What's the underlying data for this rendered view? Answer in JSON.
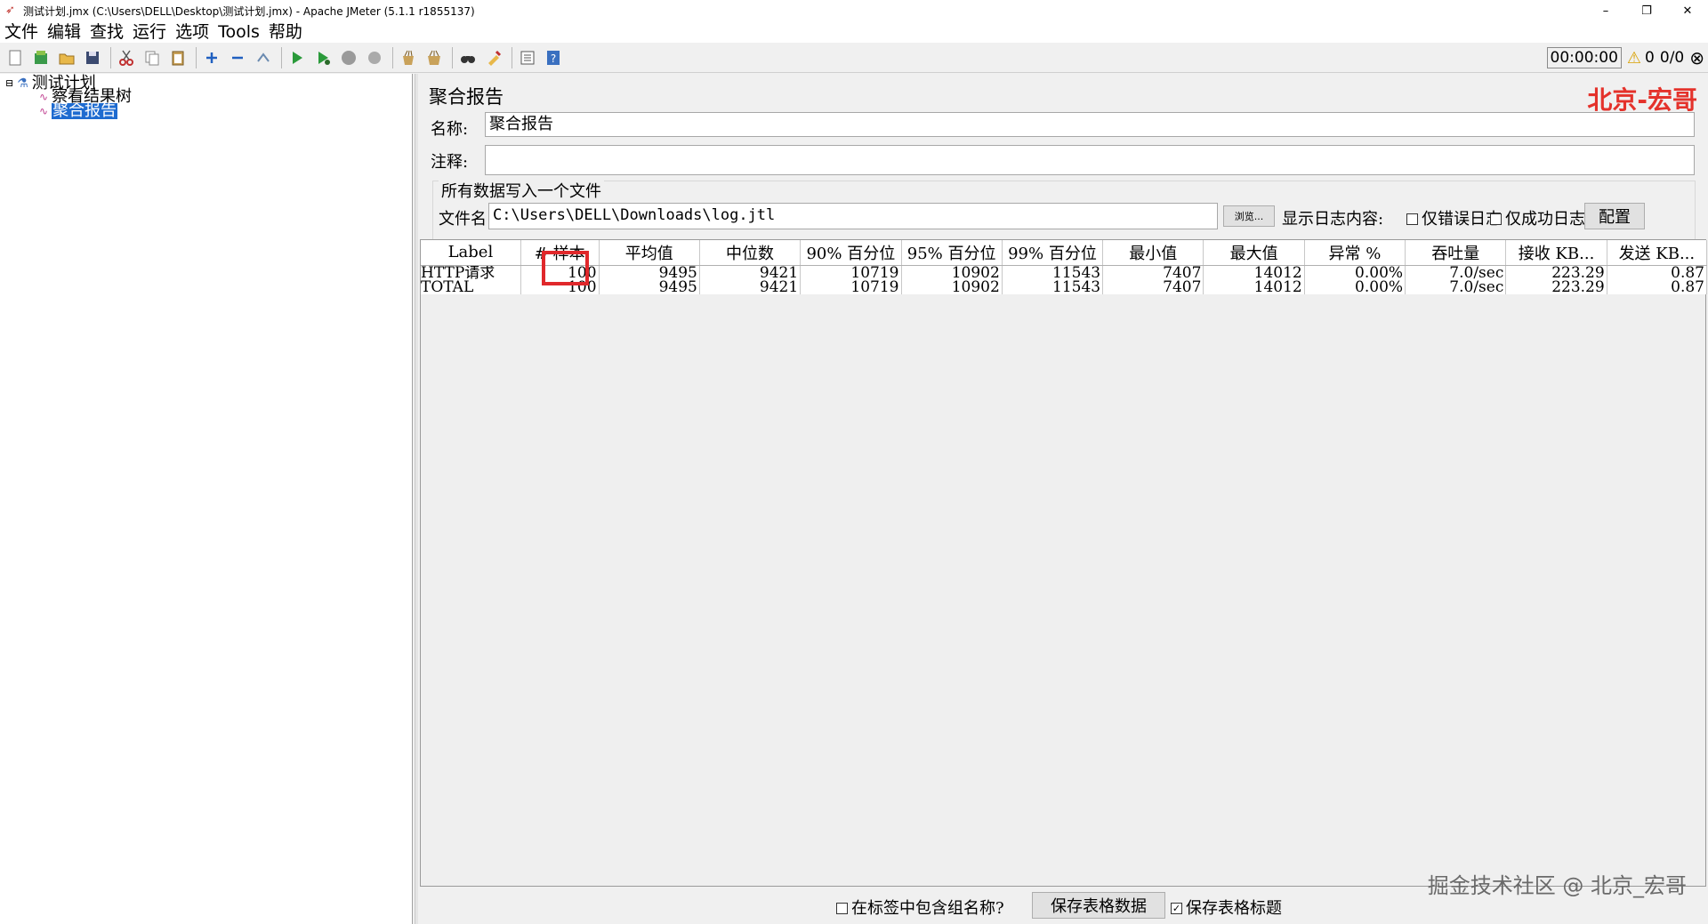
{
  "window": {
    "title": "测试计划.jmx (C:\\Users\\DELL\\Desktop\\测试计划.jmx) - Apache JMeter (5.1.1 r1855137)",
    "minimize": "–",
    "restore": "❐",
    "close": "✕"
  },
  "menu": [
    "文件",
    "编辑",
    "查找",
    "运行",
    "选项",
    "Tools",
    "帮助"
  ],
  "toolbar": {
    "timer": "00:00:00",
    "warning_count": "0",
    "threads": "0/0"
  },
  "tree": {
    "root": "测试计划",
    "children": [
      "察看结果树",
      "聚合报告"
    ],
    "selected_index": 1
  },
  "panel": {
    "title": "聚合报告",
    "watermark_top": "北京-宏哥",
    "name_label": "名称:",
    "name_value": "聚合报告",
    "comment_label": "注释:",
    "comment_value": "",
    "file_group_title": "所有数据写入一个文件",
    "filename_label": "文件名",
    "filename_value": "C:\\Users\\DELL\\Downloads\\log.jtl",
    "browse_button": "浏览...",
    "log_display_label": "显示日志内容:",
    "errors_only_label": "仅错误日志",
    "success_only_label": "仅成功日志",
    "config_button": "配置"
  },
  "table": {
    "headers": [
      "Label",
      "# 样本",
      "平均值",
      "中位数",
      "90% 百分位",
      "95% 百分位",
      "99% 百分位",
      "最小值",
      "最大值",
      "异常 %",
      "吞吐量",
      "接收 KB...",
      "发送 KB..."
    ],
    "rows": [
      [
        "HTTP请求",
        "100",
        "9495",
        "9421",
        "10719",
        "10902",
        "11543",
        "7407",
        "14012",
        "0.00%",
        "7.0/sec",
        "223.29",
        "0.87"
      ],
      [
        "TOTAL",
        "100",
        "9495",
        "9421",
        "10719",
        "10902",
        "11543",
        "7407",
        "14012",
        "0.00%",
        "7.0/sec",
        "223.29",
        "0.87"
      ]
    ]
  },
  "bottom": {
    "include_group_label": "在标签中包含组名称?",
    "save_table_button": "保存表格数据",
    "save_header_label": "保存表格标题",
    "watermark_bottom": "掘金技术社区 @ 北京_宏哥"
  },
  "colors": {
    "highlight": "#e0282b",
    "watermark": "#e4322b",
    "selection": "#1e6bd0"
  }
}
